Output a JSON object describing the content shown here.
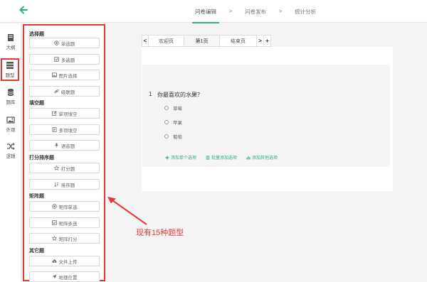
{
  "header": {
    "back_icon": "arrow-left-icon",
    "steps": [
      "问卷编辑",
      "问卷发布",
      "统计分析"
    ],
    "separators": [
      ">",
      ">"
    ],
    "accent": "#2db08a"
  },
  "rail": {
    "items": [
      {
        "label": "大纲",
        "icon": "outline-icon"
      },
      {
        "label": "题型",
        "icon": "question-types-icon"
      },
      {
        "label": "题库",
        "icon": "database-icon"
      },
      {
        "label": "外观",
        "icon": "image-icon"
      },
      {
        "label": "逻辑",
        "icon": "shuffle-icon"
      }
    ]
  },
  "panel": {
    "groups": [
      {
        "title": "选择题",
        "items": [
          "单选题",
          "多选题",
          "图片选择",
          "级联题"
        ]
      },
      {
        "title": "填空题",
        "items": [
          "单项填空",
          "多项填空",
          "语音题"
        ]
      },
      {
        "title": "打分排序题",
        "items": [
          "打分题",
          "排序题"
        ]
      },
      {
        "title": "矩阵题",
        "items": [
          "矩阵单选",
          "矩阵多选",
          "矩阵打分"
        ]
      },
      {
        "title": "其它题",
        "items": [
          "文件上传",
          "地理位置"
        ]
      }
    ]
  },
  "tabs": {
    "prev": "<",
    "next": ">",
    "add": "+",
    "items": [
      "欢迎页",
      "第1页",
      "结束页"
    ],
    "active": "第1页"
  },
  "question": {
    "number": "1",
    "title": "你最喜欢的水果？",
    "options": [
      "草莓",
      "苹果",
      "葡萄"
    ],
    "add_links": [
      "添加单个选项",
      "批量添加选项",
      "添加其他选项"
    ]
  },
  "annotation": {
    "text": "现有15种题型",
    "color": "#e53935"
  }
}
